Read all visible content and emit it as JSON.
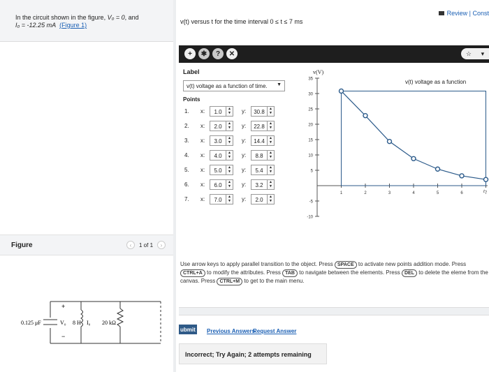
{
  "problem": {
    "line1_pre": "In the circuit shown in the figure, ",
    "v0_label": "V₀ = 0",
    "line1_post": ", and",
    "i0_label": "I₀ = -12.25 mA",
    "figure_link": "(Figure 1)"
  },
  "figure_panel": {
    "title": "Figure",
    "pager_text": "1 of 1",
    "prev_icon": "‹",
    "next_icon": "›"
  },
  "circuit": {
    "cap_label": "0.125 μF",
    "v_label": "V₀",
    "ind_label": "8 H",
    "i0_label": "I₀",
    "res_label": "20 kΩ",
    "plus": "+",
    "minus": "−"
  },
  "header": {
    "review_label": "Review | Const"
  },
  "question": {
    "text": "v(t) versus t for the time interval 0 ≤ t ≤ 7 ms"
  },
  "toolbar": {
    "add_icon": "+",
    "tool2_icon": "✱",
    "tool3_icon": "?",
    "trash_icon": "✕",
    "hint_icon": "☆",
    "menu_icon": "▾"
  },
  "label_panel": {
    "title": "Label",
    "selected_label": "v(t) voltage as a function of time.",
    "points_title": "Points",
    "x_label": "x:",
    "y_label": "y:",
    "spin_up": "▲",
    "spin_down": "▼",
    "points": [
      {
        "n": "1.",
        "x": "1.0",
        "y": "30.8"
      },
      {
        "n": "2.",
        "x": "2.0",
        "y": "22.8"
      },
      {
        "n": "3.",
        "x": "3.0",
        "y": "14.4"
      },
      {
        "n": "4.",
        "x": "4.0",
        "y": "8.8"
      },
      {
        "n": "5.",
        "x": "5.0",
        "y": "5.4"
      },
      {
        "n": "6.",
        "x": "6.0",
        "y": "3.2"
      },
      {
        "n": "7.",
        "x": "7.0",
        "y": "2.0"
      }
    ]
  },
  "chart_data": {
    "type": "line",
    "title": "v(t) voltage as a function",
    "ylabel": "v(V)",
    "xlabel": "t",
    "x_ticks": [
      "1",
      "2",
      "3",
      "4",
      "5",
      "6",
      "7"
    ],
    "y_ticks": [
      "35",
      "30",
      "25",
      "20",
      "15",
      "10",
      "5",
      "-5",
      "-10"
    ],
    "xlim": [
      0,
      7
    ],
    "ylim": [
      -10,
      35
    ],
    "series": [
      {
        "x": [
          1,
          2,
          3,
          4,
          5,
          6,
          7
        ],
        "y": [
          30.8,
          22.8,
          14.4,
          8.8,
          5.4,
          3.2,
          2.0
        ]
      }
    ],
    "color": "#2b5a8a"
  },
  "instructions": {
    "p1": "Use arrow keys to apply parallel transition to the object. Press",
    "k1": "SPACE",
    "p2": "to activate new points addition mode. Press",
    "k2": "CTRL+A",
    "p3": "to modify the attributes. Press",
    "k3": "TAB",
    "p4": "to navigate between the elements. Press",
    "k4": "DEL",
    "p5": "to delete the eleme",
    "p6": "from the canvas. Press",
    "k5": "CTRL+M",
    "p7": "to get to the main menu."
  },
  "actions": {
    "submit_label": "ubmit",
    "previous_answers": "Previous Answers",
    "request_answer": "Request Answer"
  },
  "feedback": {
    "text": "Incorrect; Try Again; 2 attempts remaining"
  }
}
